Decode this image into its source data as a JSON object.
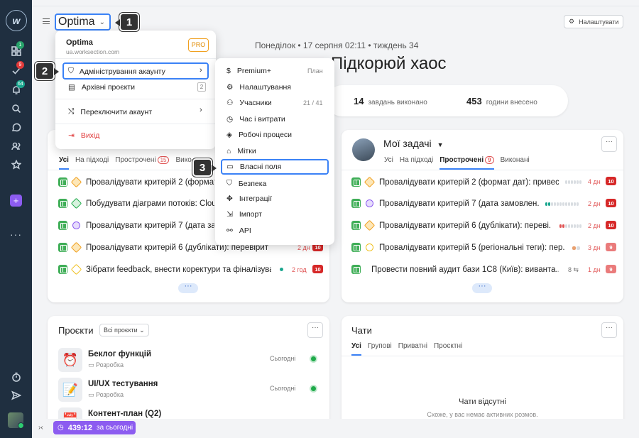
{
  "sidebar": {
    "badges": {
      "projects": "1",
      "tasks": "9",
      "notifications": "64"
    }
  },
  "header": {
    "account_name": "Optima",
    "settings_label": "Налаштувати",
    "dateline": "Понеділок • 17 серпня 02:11 • тиждень 34",
    "hero_text": "Підкорюй хаос"
  },
  "stats": {
    "done_value": "14",
    "done_label": "завдань виконано",
    "hours_value": "453",
    "hours_label": "години внесено"
  },
  "account_dropdown": {
    "name": "Optima",
    "domain": "ua.worksection.com",
    "plan_badge": "PRO",
    "admin_label": "Адміністрування акаунту",
    "archive_label": "Архівні проєкти",
    "archive_count": "2",
    "switch_label": "Переключити акаунт",
    "logout_label": "Вихід"
  },
  "admin_submenu": {
    "items": [
      {
        "label": "Premium+",
        "right": "План"
      },
      {
        "label": "Налаштування",
        "right": ""
      },
      {
        "label": "Учасники",
        "right": "21 / 41"
      },
      {
        "label": "Час і витрати",
        "right": ""
      },
      {
        "label": "Робочі процеси",
        "right": ""
      },
      {
        "label": "Мітки",
        "right": ""
      },
      {
        "label": "Власні поля",
        "right": ""
      },
      {
        "label": "Безпека",
        "right": ""
      },
      {
        "label": "Інтеграції",
        "right": ""
      },
      {
        "label": "Імпорт",
        "right": ""
      },
      {
        "label": "API",
        "right": ""
      }
    ]
  },
  "callouts": [
    "1",
    "2",
    "3"
  ],
  "left_tasks": {
    "tabs": [
      "Усі",
      "На підході",
      "Прострочені",
      "Вико"
    ],
    "overdue_count": "15",
    "rows": [
      {
        "title": "Провалідувати критерій 2 (формат",
        "days": "",
        "badge": ""
      },
      {
        "title": "Побудувати діаграми потоків: Clouc",
        "days": "",
        "badge": ""
      },
      {
        "title": "Провалідувати критерій 7 (дата зам",
        "days": "",
        "badge": ""
      },
      {
        "title": "Провалідувати критерій 6 (дублікати): перевірит",
        "days": "2 дн",
        "badge": "10"
      },
      {
        "title": "Зібрати feedback, внести коректури та фіналізува...",
        "days": "2 год",
        "badge": "10"
      }
    ],
    "more": "···"
  },
  "my_tasks": {
    "title": "Мої задачі",
    "tabs": [
      "Усі",
      "На підході",
      "Прострочені",
      "Виконані"
    ],
    "overdue_count": "9",
    "rows": [
      {
        "title": "Провалідувати критерій 2 (формат дат): привес...",
        "days": "4 дн",
        "badge": "10"
      },
      {
        "title": "Провалідувати критерій 7 (дата замовлен...",
        "days": "2 дн",
        "badge": "10"
      },
      {
        "title": "Провалідувати критерій 6 (дублікати): переві...",
        "days": "2 дн",
        "badge": "10"
      },
      {
        "title": "Провалідувати критерій 5 (регіональні теги): пер...",
        "days": "3 дн",
        "badge": "9"
      },
      {
        "title": "Провести повний аудит бази 1С8 (Київ): виванта...",
        "days": "1 дн",
        "badge": "9",
        "subtasks": "8"
      }
    ],
    "more": "···"
  },
  "projects": {
    "title": "Проєкти",
    "filter": "Всі проєкти",
    "items": [
      {
        "name": "Беклог функцій",
        "folder": "Розробка",
        "date": "Сьогодні",
        "icon": "⏰"
      },
      {
        "name": "UI/UX тестування",
        "folder": "Розробка",
        "date": "Сьогодні",
        "icon": "📝"
      },
      {
        "name": "Контент-план (Q2)",
        "folder": "",
        "date": "",
        "icon": "📅"
      }
    ]
  },
  "chats": {
    "title": "Чати",
    "tabs": [
      "Усі",
      "Групові",
      "Приватні",
      "Проєктні"
    ],
    "empty_title": "Чати відсутні",
    "empty_sub": "Схоже, у вас немає активних розмов."
  },
  "timer": {
    "value": "439:12",
    "label": "за сьогодні"
  }
}
